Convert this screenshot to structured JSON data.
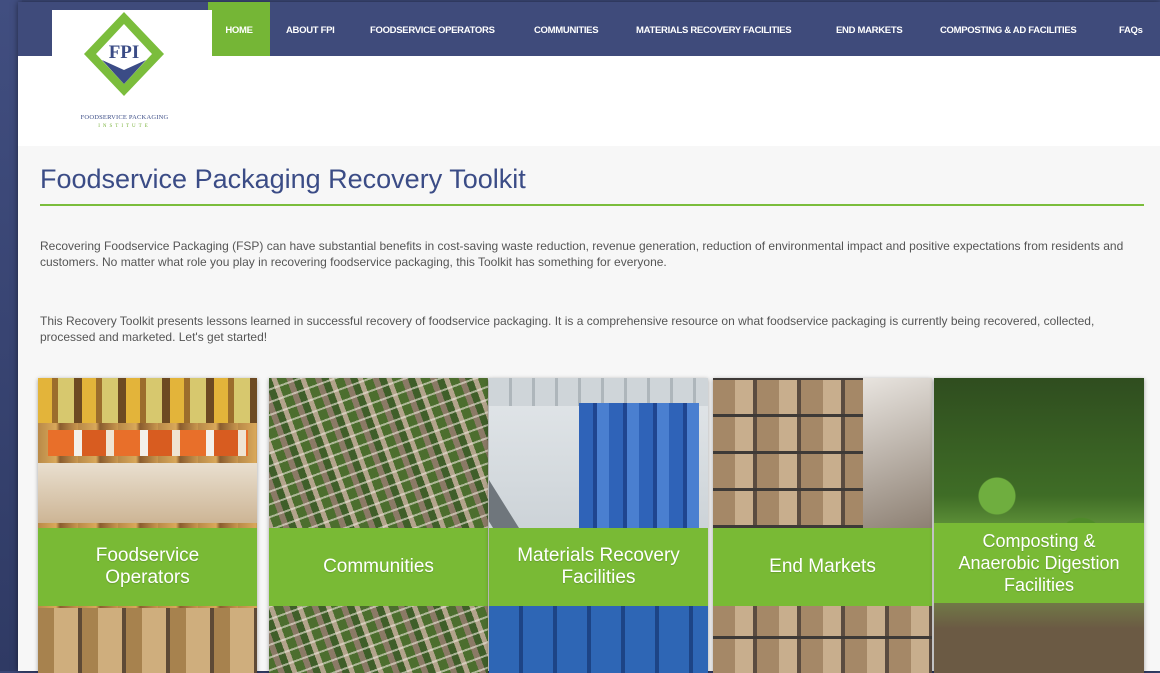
{
  "logo": {
    "acronym": "FPI",
    "name": "FOODSERVICE PACKAGING",
    "tagline": "INSTITUTE"
  },
  "nav": [
    {
      "label": "HOME",
      "active": true
    },
    {
      "label": "ABOUT FPI"
    },
    {
      "label": "FOODSERVICE OPERATORS"
    },
    {
      "label": "COMMUNITIES"
    },
    {
      "label": "MATERIALS RECOVERY FACILITIES"
    },
    {
      "label": "END MARKETS"
    },
    {
      "label": "COMPOSTING & AD FACILITIES"
    },
    {
      "label": "FAQs"
    }
  ],
  "main": {
    "title": "Foodservice Packaging Recovery Toolkit",
    "paragraphs": [
      "Recovering Foodservice Packaging (FSP) can have substantial benefits in cost-saving waste reduction, revenue generation, reduction of environmental impact and positive expectations from residents and customers. No matter what role you play in recovering foodservice packaging, this Toolkit has something for everyone.",
      "This Recovery Toolkit presents lessons learned in successful recovery of foodservice packaging. It is a comprehensive resource on what foodservice packaging is currently being recovered, collected, processed and marketed. Let's get started!"
    ]
  },
  "cards": [
    {
      "label": "Foodservice Operators"
    },
    {
      "label": "Communities"
    },
    {
      "label": "Materials Recovery Facilities"
    },
    {
      "label": "End Markets"
    },
    {
      "label": "Composting & Anaerobic Digestion Facilities"
    }
  ],
  "colors": {
    "navy": "#3f4b7b",
    "green": "#75b636",
    "title": "#3b4c86"
  }
}
